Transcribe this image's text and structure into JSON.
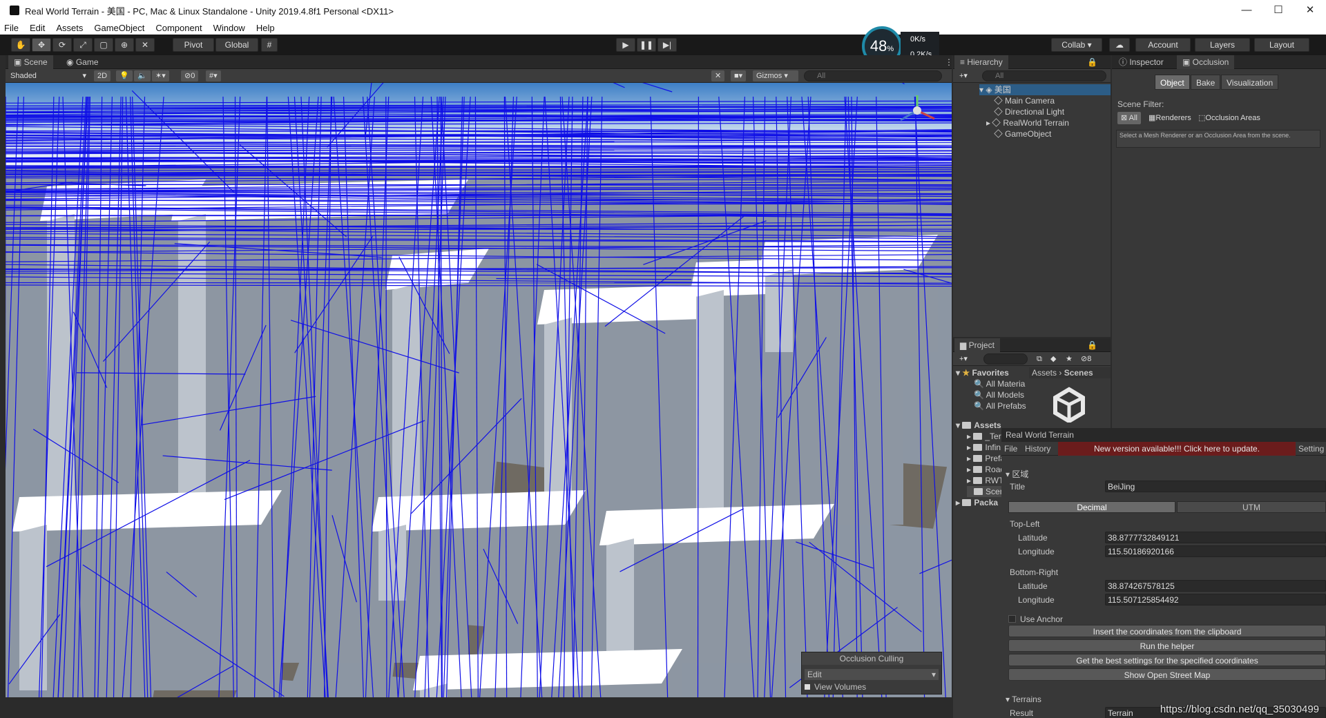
{
  "window": {
    "title": "Real World Terrain - 美国 - PC, Mac & Linux Standalone - Unity 2019.4.8f1 Personal <DX11>",
    "minimize": "—",
    "maximize": "☐",
    "close": "✕"
  },
  "menu": [
    "File",
    "Edit",
    "Assets",
    "GameObject",
    "Component",
    "Window",
    "Help"
  ],
  "toolbar": {
    "pivot": "Pivot",
    "global": "Global",
    "collab": "Collab ▾",
    "account": "Account",
    "layers": "Layers",
    "layout": "Layout",
    "play": "▶",
    "pause": "❚❚",
    "step": "▶|"
  },
  "stats": {
    "percent": "48",
    "percent_unit": "%",
    "up": "0",
    "up_unit": "K/s",
    "down": "0.2",
    "down_unit": "K/s"
  },
  "scene": {
    "tab_scene": "Scene",
    "tab_game": "Game",
    "shading": "Shaded",
    "mode2d": "2D",
    "hidden_count": "0",
    "gizmos": "Gizmos",
    "search_placeholder": "All",
    "occlusion_popup": {
      "title": "Occlusion Culling",
      "mode": "Edit",
      "view_volumes": "View Volumes"
    }
  },
  "hierarchy": {
    "tab": "Hierarchy",
    "search_placeholder": "All",
    "scene_name": "美国",
    "items": [
      "Main Camera",
      "Directional Light",
      "RealWorld Terrain",
      "GameObject"
    ]
  },
  "inspector": {
    "tab_inspector": "Inspector",
    "tab_occlusion": "Occlusion",
    "modes": [
      "Object",
      "Bake",
      "Visualization"
    ],
    "scene_filter_label": "Scene Filter:",
    "filters": [
      "All",
      "Renderers",
      "Occlusion Areas"
    ],
    "help": "Select a Mesh Renderer or an Occlusion Area from the scene."
  },
  "project": {
    "tab": "Project",
    "hidden_count": "8",
    "favorites_label": "Favorites",
    "favorites": [
      "All Materia",
      "All Models",
      "All Prefabs"
    ],
    "assets_label": "Assets",
    "assets": [
      "_Ter",
      "Infin",
      "Prefa",
      "Road",
      "RWT",
      "Scen"
    ],
    "packages_label": "Packa",
    "breadcrumb": [
      "Assets",
      "Scenes"
    ]
  },
  "rwt": {
    "window_title": "Real World Terrain",
    "tab_file": "File",
    "tab_history": "History",
    "update_notice": "New version available!!! Click here to update.",
    "settings_tab": "Setting",
    "area_section": "区域",
    "title_label": "Title",
    "title_value": "BeiJing",
    "coord_tabs": [
      "Decimal",
      "UTM"
    ],
    "top_left_label": "Top-Left",
    "bottom_right_label": "Bottom-Right",
    "latitude_label": "Latitude",
    "longitude_label": "Longitude",
    "tl_lat": "38.8777732849121",
    "tl_lon": "115.50186920166",
    "br_lat": "38.874267578125",
    "br_lon": "115.507125854492",
    "use_anchor": "Use Anchor",
    "buttons": [
      "Insert the coordinates from the clipboard",
      "Run the helper",
      "Get the best settings for the specified coordinates",
      "Show Open Street Map"
    ],
    "terrains_section": "Terrains",
    "result_label": "Result",
    "result_value": "Terrain"
  },
  "watermark": "https://blog.csdn.net/qq_35030499",
  "colors": {
    "wireframe": "#1010e0",
    "sky": "#dde7f3",
    "accent_update": "#6b1c1c"
  }
}
